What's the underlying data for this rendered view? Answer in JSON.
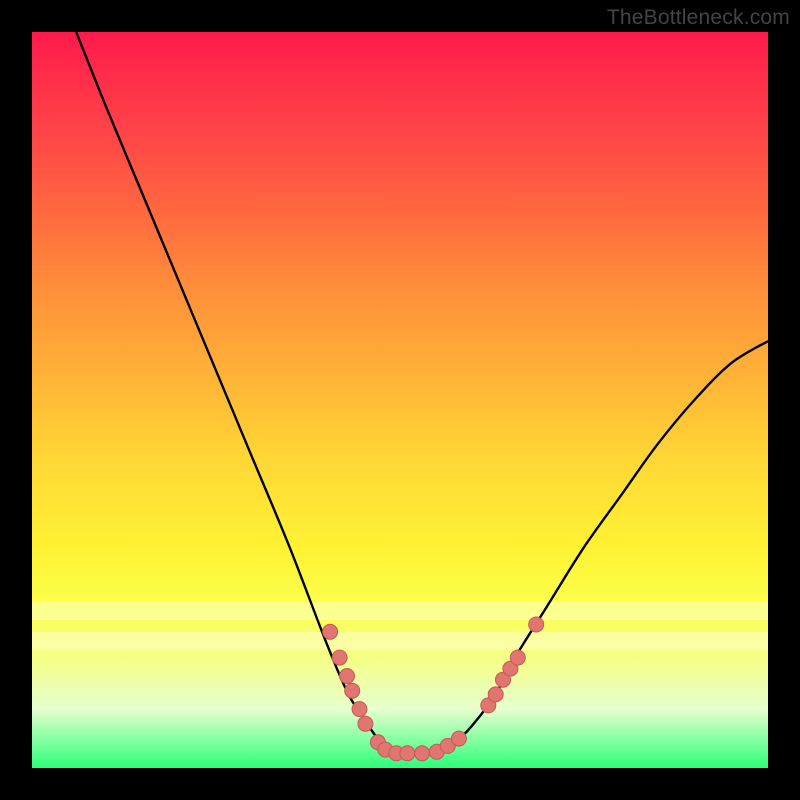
{
  "watermark": "TheBottleneck.com",
  "colors": {
    "background": "#000000",
    "curve": "#000000",
    "dot_fill": "#e0766f",
    "dot_stroke": "#c45a55",
    "gradient_top": "#ff1a4b",
    "gradient_bottom": "#2bff7a"
  },
  "chart_data": {
    "type": "line",
    "title": "",
    "xlabel": "",
    "ylabel": "",
    "xlim": [
      0,
      100
    ],
    "ylim": [
      0,
      100
    ],
    "series": [
      {
        "name": "curve",
        "x": [
          6,
          10,
          15,
          20,
          25,
          30,
          35,
          40,
          43,
          45,
          47,
          50,
          53,
          55,
          58,
          60,
          63,
          65,
          70,
          75,
          80,
          85,
          90,
          95,
          100
        ],
        "y": [
          100,
          90,
          78,
          66,
          54,
          42,
          30,
          17,
          10,
          7,
          4,
          2,
          2,
          2,
          4,
          6,
          10,
          14,
          22,
          30,
          37,
          44,
          50,
          55,
          58
        ]
      }
    ],
    "dots": {
      "name": "markers",
      "points": [
        {
          "x": 40.5,
          "y": 18.5
        },
        {
          "x": 41.8,
          "y": 15.0
        },
        {
          "x": 42.8,
          "y": 12.5
        },
        {
          "x": 43.5,
          "y": 10.5
        },
        {
          "x": 44.5,
          "y": 8.0
        },
        {
          "x": 45.3,
          "y": 6.0
        },
        {
          "x": 47.0,
          "y": 3.5
        },
        {
          "x": 48.0,
          "y": 2.5
        },
        {
          "x": 49.5,
          "y": 2.0
        },
        {
          "x": 51.0,
          "y": 2.0
        },
        {
          "x": 53.0,
          "y": 2.0
        },
        {
          "x": 55.0,
          "y": 2.2
        },
        {
          "x": 56.5,
          "y": 3.0
        },
        {
          "x": 58.0,
          "y": 4.0
        },
        {
          "x": 62.0,
          "y": 8.5
        },
        {
          "x": 63.0,
          "y": 10.0
        },
        {
          "x": 64.0,
          "y": 12.0
        },
        {
          "x": 65.0,
          "y": 13.5
        },
        {
          "x": 66.0,
          "y": 15.0
        },
        {
          "x": 68.5,
          "y": 19.5
        }
      ]
    },
    "highlight_bands_y": [
      {
        "from": 20.0,
        "to": 22.5
      },
      {
        "from": 16.0,
        "to": 18.5
      }
    ]
  }
}
